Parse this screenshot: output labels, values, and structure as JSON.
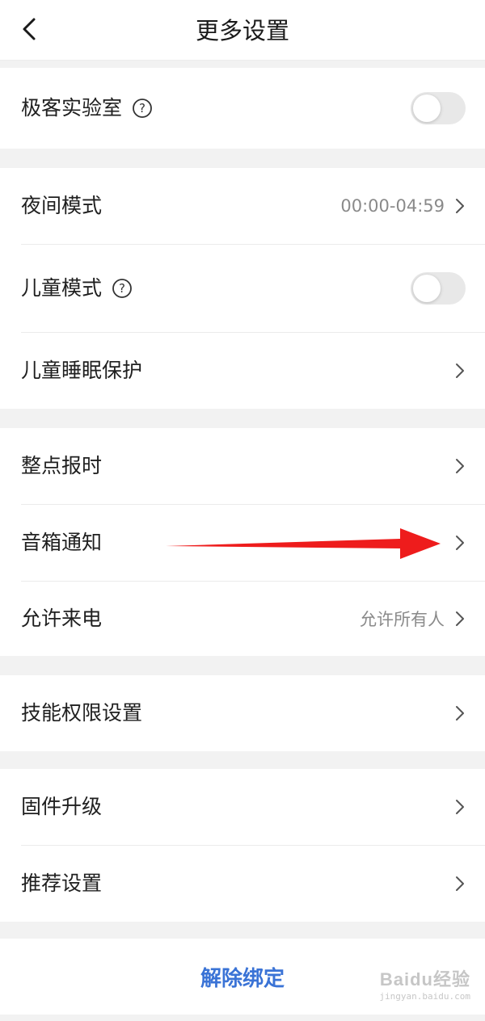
{
  "header": {
    "title": "更多设置"
  },
  "rows": {
    "geek_lab": {
      "label": "极客实验室",
      "toggle_on": false
    },
    "night_mode": {
      "label": "夜间模式",
      "value": "00:00-04:59"
    },
    "child_mode": {
      "label": "儿童模式",
      "toggle_on": false
    },
    "child_sleep": {
      "label": "儿童睡眠保护"
    },
    "hourly_chime": {
      "label": "整点报时"
    },
    "speaker_notice": {
      "label": "音箱通知"
    },
    "allow_calls": {
      "label": "允许来电",
      "value": "允许所有人"
    },
    "skill_permissions": {
      "label": "技能权限设置"
    },
    "firmware_upgrade": {
      "label": "固件升级"
    },
    "recommend_settings": {
      "label": "推荐设置"
    }
  },
  "actions": {
    "unbind_label": "解除绑定"
  },
  "watermark": {
    "brand": "Baidu经验",
    "url": "jingyan.baidu.com"
  },
  "colors": {
    "accent": "#3a73d6",
    "annotation_arrow": "#ee1c1c",
    "toggle_off": "#e8e8e8"
  }
}
